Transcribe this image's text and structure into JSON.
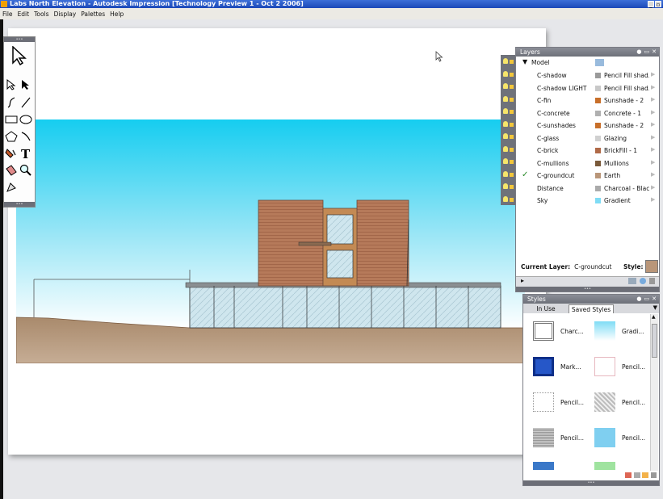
{
  "window": {
    "title": "Labs North Elevation - Autodesk Impression [Technology Preview 1 - Oct  2 2006]"
  },
  "menu": [
    "File",
    "Edit",
    "Tools",
    "Display",
    "Palettes",
    "Help"
  ],
  "tools": [
    "pointer-tool",
    "select-tool",
    "direct-select-tool",
    "curve-tool",
    "line-tool",
    "rectangle-tool",
    "ellipse-tool",
    "polygon-tool",
    "arc-tool",
    "fill-tool",
    "text-tool",
    "eraser-tool",
    "zoom-tool",
    "pan-tool"
  ],
  "layers": {
    "title": "Layers",
    "group": "Model",
    "rows": [
      {
        "name": "C-shadow",
        "style": "Pencil  Fill  shad..",
        "color": "#9a9a9a"
      },
      {
        "name": "C-shadow LIGHT",
        "style": "Pencil  Fill  shad..",
        "color": "#c8c8c8"
      },
      {
        "name": "C-fin",
        "style": "Sunshade - 2",
        "color": "#c86f2a"
      },
      {
        "name": "C-concrete",
        "style": "Concrete - 1",
        "color": "#b0b0b0"
      },
      {
        "name": "C-sunshades",
        "style": "Sunshade - 2",
        "color": "#c86f2a"
      },
      {
        "name": "C-glass",
        "style": "Glazing",
        "color": "#d0d0d0"
      },
      {
        "name": "C-brick",
        "style": "BrickFill - 1",
        "color": "#b06a48"
      },
      {
        "name": "C-mullions",
        "style": "Mullions",
        "color": "#7a5a3a"
      },
      {
        "name": "C-groundcut",
        "style": "Earth",
        "color": "#b99679",
        "current": true
      },
      {
        "name": "Distance",
        "style": "Charcoal - Black",
        "color": "#aaaaaa"
      },
      {
        "name": "Sky",
        "style": "Gradient",
        "color": "#7fdcf5"
      }
    ],
    "current_layer_label": "Current Layer:",
    "current_layer_value": "C-groundcut",
    "style_label": "Style:",
    "style_color": "#b99679"
  },
  "styles": {
    "title": "Styles",
    "tabs": [
      "In Use",
      "Saved Styles"
    ],
    "active_tab": "Saved Styles",
    "items": [
      {
        "label": "Charc...",
        "kind": "charcoal-frame"
      },
      {
        "label": "Gradi...",
        "kind": "gradient"
      },
      {
        "label": "Mark...",
        "kind": "marker-blue"
      },
      {
        "label": "Pencil...",
        "kind": "pencil-pink"
      },
      {
        "label": "Pencil...",
        "kind": "pencil-dotted"
      },
      {
        "label": "Pencil...",
        "kind": "pencil-hatch"
      },
      {
        "label": "Pencil...",
        "kind": "pencil-gray"
      },
      {
        "label": "Pencil...",
        "kind": "pencil-blue"
      }
    ]
  }
}
